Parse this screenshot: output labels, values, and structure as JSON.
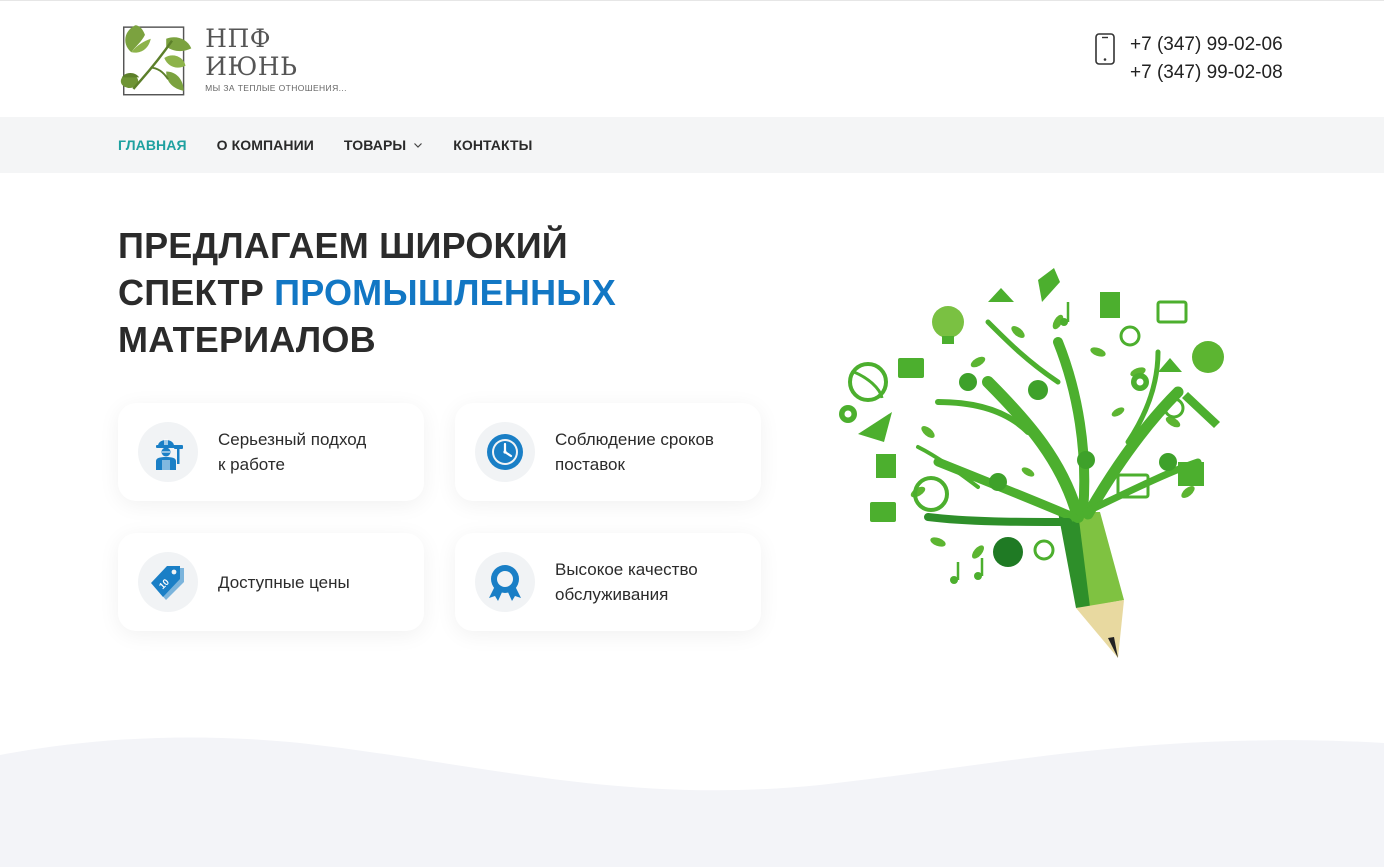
{
  "brand": {
    "name": "НПФ ИЮНЬ",
    "tagline": "МЫ ЗА ТЕПЛЫЕ ОТНОШЕНИЯ..."
  },
  "header": {
    "phones": [
      "+7 (347) 99-02-06",
      "+7 (347) 99-02-08"
    ],
    "phone_icon": "mobile-phone-icon"
  },
  "nav": {
    "items": [
      {
        "label": "ГЛАВНАЯ",
        "active": true
      },
      {
        "label": "О КОМПАНИИ",
        "active": false
      },
      {
        "label": "ТОВАРЫ",
        "active": false,
        "has_dropdown": true
      },
      {
        "label": "КОНТАКТЫ",
        "active": false
      }
    ]
  },
  "hero": {
    "title_line1": "ПРЕДЛАГАЕМ ШИРОКИЙ",
    "title_line2_prefix": "СПЕКТР ",
    "title_line2_accent": "ПРОМЫШЛЕННЫХ",
    "title_line3": "МАТЕРИАЛОВ"
  },
  "features": [
    {
      "line1": "Серьезный подход",
      "line2": "к работе",
      "icon": "worker-icon"
    },
    {
      "line1": "Соблюдение сроков",
      "line2": "поставок",
      "icon": "clock-icon"
    },
    {
      "line1": "Доступные цены",
      "line2": "",
      "icon": "price-tag-icon"
    },
    {
      "line1": "Высокое качество",
      "line2": "обслуживания",
      "icon": "award-ribbon-icon"
    }
  ],
  "colors": {
    "accent_blue": "#1277c4",
    "nav_active": "#1ea1a0",
    "icon_blue": "#1a7fc6",
    "tree_green": "#4caf2e",
    "nav_bg": "#f4f5f6",
    "wave_bg": "#f3f4f8"
  }
}
